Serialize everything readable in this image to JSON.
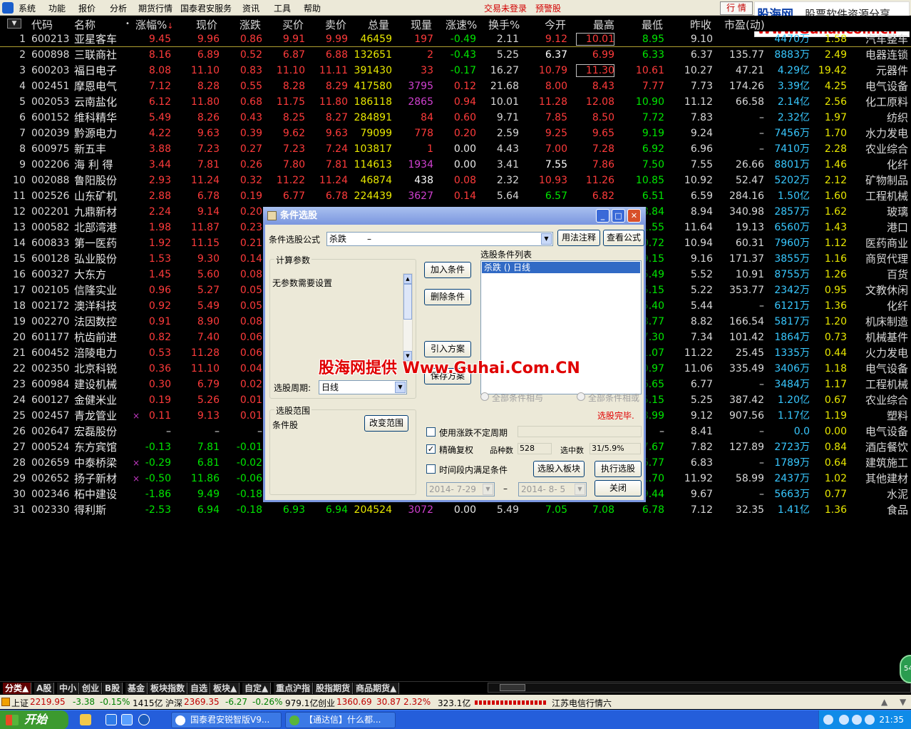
{
  "menu": {
    "items": [
      "系统",
      "功能",
      "报价",
      "分析",
      "期货行情",
      "国泰君安服务",
      "资讯",
      "工具",
      "帮助"
    ],
    "login_status": "交易未登录",
    "alert": "预警股",
    "hq_button": "行 情"
  },
  "banner": {
    "line1": "股海网",
    "line2": "股票软件资源分享",
    "line3": "Www.Guhai.com.cn"
  },
  "columns": {
    "code": "代码",
    "name": "名称",
    "pct": "涨幅%",
    "price": "现价",
    "chg": "涨跌",
    "bid": "买价",
    "ask": "卖价",
    "vol": "总量",
    "cur": "现量",
    "spd": "涨速%",
    "turn": "换手%",
    "open": "今开",
    "high": "最高",
    "low": "最低",
    "pre": "昨收",
    "pe": "市盈(动)"
  },
  "rows": [
    {
      "i": "1",
      "code": "600213",
      "name": "亚星客车",
      "mk": "",
      "pct": "9.45",
      "price": "9.96",
      "chg": "0.86",
      "bid": "9.91",
      "ask": "9.99",
      "vol": "46459",
      "cur": "197",
      "spd": "-0.49",
      "turn": "2.11",
      "open": "9.12",
      "high": "10.01",
      "low": "8.95",
      "pre": "9.10",
      "pe": "",
      "amt": "4470",
      "amtu": "万",
      "x": "1.58",
      "ind": "汽车整车"
    },
    {
      "i": "2",
      "code": "600898",
      "name": "三联商社",
      "mk": "",
      "pct": "8.16",
      "price": "6.89",
      "chg": "0.52",
      "bid": "6.87",
      "ask": "6.88",
      "vol": "132651",
      "cur": "2",
      "spd": "-0.43",
      "turn": "5.25",
      "open": "6.37",
      "high": "6.99",
      "low": "6.33",
      "pre": "6.37",
      "pe": "135.77",
      "amt": "8883",
      "amtu": "万",
      "x": "2.49",
      "ind": "电器连锁"
    },
    {
      "i": "3",
      "code": "600203",
      "name": "福日电子",
      "mk": "",
      "pct": "8.08",
      "price": "11.10",
      "chg": "0.83",
      "bid": "11.10",
      "ask": "11.11",
      "vol": "391430",
      "cur": "33",
      "spd": "-0.17",
      "turn": "16.27",
      "open": "10.79",
      "high": "11.30",
      "low": "10.61",
      "pre": "10.27",
      "pe": "47.21",
      "amt": "4.29",
      "amtu": "亿",
      "x": "19.42",
      "ind": "元器件"
    },
    {
      "i": "4",
      "code": "002451",
      "name": "摩恩电气",
      "mk": "",
      "pct": "7.12",
      "price": "8.28",
      "chg": "0.55",
      "bid": "8.28",
      "ask": "8.29",
      "vol": "417580",
      "cur": "3795",
      "spd": "0.12",
      "turn": "21.68",
      "open": "8.00",
      "high": "8.43",
      "low": "7.77",
      "pre": "7.73",
      "pe": "174.26",
      "amt": "3.39",
      "amtu": "亿",
      "x": "4.25",
      "ind": "电气设备"
    },
    {
      "i": "5",
      "code": "002053",
      "name": "云南盐化",
      "mk": "",
      "pct": "6.12",
      "price": "11.80",
      "chg": "0.68",
      "bid": "11.75",
      "ask": "11.80",
      "vol": "186118",
      "cur": "2865",
      "spd": "0.94",
      "turn": "10.01",
      "open": "11.28",
      "high": "12.08",
      "low": "10.90",
      "pre": "11.12",
      "pe": "66.58",
      "amt": "2.14",
      "amtu": "亿",
      "x": "2.56",
      "ind": "化工原料"
    },
    {
      "i": "6",
      "code": "600152",
      "name": "维科精华",
      "mk": "",
      "pct": "5.49",
      "price": "8.26",
      "chg": "0.43",
      "bid": "8.25",
      "ask": "8.27",
      "vol": "284891",
      "cur": "84",
      "spd": "0.60",
      "turn": "9.71",
      "open": "7.85",
      "high": "8.50",
      "low": "7.72",
      "pre": "7.83",
      "pe": "–",
      "amt": "2.32",
      "amtu": "亿",
      "x": "1.97",
      "ind": "纺织"
    },
    {
      "i": "7",
      "code": "002039",
      "name": "黔源电力",
      "mk": "",
      "pct": "4.22",
      "price": "9.63",
      "chg": "0.39",
      "bid": "9.62",
      "ask": "9.63",
      "vol": "79099",
      "cur": "778",
      "spd": "0.20",
      "turn": "2.59",
      "open": "9.25",
      "high": "9.65",
      "low": "9.19",
      "pre": "9.24",
      "pe": "–",
      "amt": "7456",
      "amtu": "万",
      "x": "1.70",
      "ind": "水力发电"
    },
    {
      "i": "8",
      "code": "600975",
      "name": "新五丰",
      "mk": "",
      "pct": "3.88",
      "price": "7.23",
      "chg": "0.27",
      "bid": "7.23",
      "ask": "7.24",
      "vol": "103817",
      "cur": "1",
      "spd": "0.00",
      "turn": "4.43",
      "open": "7.00",
      "high": "7.28",
      "low": "6.92",
      "pre": "6.96",
      "pe": "–",
      "amt": "7410",
      "amtu": "万",
      "x": "2.28",
      "ind": "农业综合"
    },
    {
      "i": "9",
      "code": "002206",
      "name": "海 利 得",
      "mk": "",
      "pct": "3.44",
      "price": "7.81",
      "chg": "0.26",
      "bid": "7.80",
      "ask": "7.81",
      "vol": "114613",
      "cur": "1934",
      "spd": "0.00",
      "turn": "3.41",
      "open": "7.55",
      "high": "7.86",
      "low": "7.50",
      "pre": "7.55",
      "pe": "26.66",
      "amt": "8801",
      "amtu": "万",
      "x": "1.46",
      "ind": "化纤"
    },
    {
      "i": "10",
      "code": "002088",
      "name": "鲁阳股份",
      "mk": "",
      "pct": "2.93",
      "price": "11.24",
      "chg": "0.32",
      "bid": "11.22",
      "ask": "11.24",
      "vol": "46874",
      "cur": "438",
      "spd": "0.08",
      "turn": "2.32",
      "open": "10.93",
      "high": "11.26",
      "low": "10.85",
      "pre": "10.92",
      "pe": "52.47",
      "amt": "5202",
      "amtu": "万",
      "x": "2.12",
      "ind": "矿物制品"
    },
    {
      "i": "11",
      "code": "002526",
      "name": "山东矿机",
      "mk": "",
      "pct": "2.88",
      "price": "6.78",
      "chg": "0.19",
      "bid": "6.77",
      "ask": "6.78",
      "vol": "224439",
      "cur": "3627",
      "spd": "0.14",
      "turn": "5.64",
      "open": "6.57",
      "high": "6.82",
      "low": "6.51",
      "pre": "6.59",
      "pe": "284.16",
      "amt": "1.50",
      "amtu": "亿",
      "x": "1.60",
      "ind": "工程机械"
    },
    {
      "i": "12",
      "code": "002201",
      "name": "九鼎新材",
      "mk": "",
      "pct": "2.24",
      "price": "9.14",
      "chg": "0.20",
      "bid": "",
      "ask": "",
      "vol": "",
      "cur": "",
      "spd": "",
      "turn": "",
      "open": "",
      "high": "",
      "low": "8.84",
      "pre": "8.94",
      "pe": "340.98",
      "amt": "2857",
      "amtu": "万",
      "x": "1.62",
      "ind": "玻璃"
    },
    {
      "i": "13",
      "code": "000582",
      "name": "北部湾港",
      "mk": "",
      "pct": "1.98",
      "price": "11.87",
      "chg": "0.23",
      "bid": "",
      "ask": "",
      "vol": "",
      "cur": "",
      "spd": "",
      "turn": "",
      "open": "",
      "high": "",
      "low": "1.55",
      "pre": "11.64",
      "pe": "19.13",
      "amt": "6560",
      "amtu": "万",
      "x": "1.43",
      "ind": "港口"
    },
    {
      "i": "14",
      "code": "600833",
      "name": "第一医药",
      "mk": "",
      "pct": "1.92",
      "price": "11.15",
      "chg": "0.21",
      "bid": "",
      "ask": "",
      "vol": "",
      "cur": "",
      "spd": "",
      "turn": "",
      "open": "",
      "high": "",
      "low": "0.72",
      "pre": "10.94",
      "pe": "60.31",
      "amt": "7960",
      "amtu": "万",
      "x": "1.12",
      "ind": "医药商业"
    },
    {
      "i": "15",
      "code": "600128",
      "name": "弘业股份",
      "mk": "",
      "pct": "1.53",
      "price": "9.30",
      "chg": "0.14",
      "bid": "",
      "ask": "",
      "vol": "",
      "cur": "",
      "spd": "",
      "turn": "",
      "open": "",
      "high": "",
      "low": "9.15",
      "pre": "9.16",
      "pe": "171.37",
      "amt": "3855",
      "amtu": "万",
      "x": "1.16",
      "ind": "商贸代理"
    },
    {
      "i": "16",
      "code": "600327",
      "name": "大东方",
      "mk": "",
      "pct": "1.45",
      "price": "5.60",
      "chg": "0.08",
      "bid": "",
      "ask": "",
      "vol": "",
      "cur": "",
      "spd": "",
      "turn": "",
      "open": "",
      "high": "",
      "low": "5.49",
      "pre": "5.52",
      "pe": "10.91",
      "amt": "8755",
      "amtu": "万",
      "x": "1.26",
      "ind": "百货"
    },
    {
      "i": "17",
      "code": "002105",
      "name": "信隆实业",
      "mk": "",
      "pct": "0.96",
      "price": "5.27",
      "chg": "0.05",
      "bid": "",
      "ask": "",
      "vol": "",
      "cur": "",
      "spd": "",
      "turn": "",
      "open": "",
      "high": "",
      "low": "5.15",
      "pre": "5.22",
      "pe": "353.77",
      "amt": "2342",
      "amtu": "万",
      "x": "0.95",
      "ind": "文教休闲"
    },
    {
      "i": "18",
      "code": "002172",
      "name": "澳洋科技",
      "mk": "",
      "pct": "0.92",
      "price": "5.49",
      "chg": "0.05",
      "bid": "",
      "ask": "",
      "vol": "",
      "cur": "",
      "spd": "",
      "turn": "",
      "open": "",
      "high": "",
      "low": "5.40",
      "pre": "5.44",
      "pe": "–",
      "amt": "6121",
      "amtu": "万",
      "x": "1.36",
      "ind": "化纤"
    },
    {
      "i": "19",
      "code": "002270",
      "name": "法因数控",
      "mk": "",
      "pct": "0.91",
      "price": "8.90",
      "chg": "0.08",
      "bid": "",
      "ask": "",
      "vol": "",
      "cur": "",
      "spd": "",
      "turn": "",
      "open": "",
      "high": "",
      "low": "8.77",
      "pre": "8.82",
      "pe": "166.54",
      "amt": "5817",
      "amtu": "万",
      "x": "1.20",
      "ind": "机床制造"
    },
    {
      "i": "20",
      "code": "601177",
      "name": "杭齿前进",
      "mk": "",
      "pct": "0.82",
      "price": "7.40",
      "chg": "0.06",
      "bid": "",
      "ask": "",
      "vol": "",
      "cur": "",
      "spd": "",
      "turn": "",
      "open": "",
      "high": "",
      "low": "7.30",
      "pre": "7.34",
      "pe": "101.42",
      "amt": "1864",
      "amtu": "万",
      "x": "0.73",
      "ind": "机械基件"
    },
    {
      "i": "21",
      "code": "600452",
      "name": "涪陵电力",
      "mk": "",
      "pct": "0.53",
      "price": "11.28",
      "chg": "0.06",
      "bid": "",
      "ask": "",
      "vol": "",
      "cur": "",
      "spd": "",
      "turn": "",
      "open": "",
      "high": "",
      "low": "1.07",
      "pre": "11.22",
      "pe": "25.45",
      "amt": "1335",
      "amtu": "万",
      "x": "0.44",
      "ind": "火力发电"
    },
    {
      "i": "22",
      "code": "002350",
      "name": "北京科锐",
      "mk": "",
      "pct": "0.36",
      "price": "11.10",
      "chg": "0.04",
      "bid": "",
      "ask": "",
      "vol": "",
      "cur": "",
      "spd": "",
      "turn": "",
      "open": "",
      "high": "",
      "low": "0.97",
      "pre": "11.06",
      "pe": "335.49",
      "amt": "3406",
      "amtu": "万",
      "x": "1.18",
      "ind": "电气设备"
    },
    {
      "i": "23",
      "code": "600984",
      "name": "建设机械",
      "mk": "",
      "pct": "0.30",
      "price": "6.79",
      "chg": "0.02",
      "bid": "",
      "ask": "",
      "vol": "",
      "cur": "",
      "spd": "",
      "turn": "",
      "open": "",
      "high": "",
      "low": "6.65",
      "pre": "6.77",
      "pe": "–",
      "amt": "3484",
      "amtu": "万",
      "x": "1.17",
      "ind": "工程机械"
    },
    {
      "i": "24",
      "code": "600127",
      "name": "金健米业",
      "mk": "",
      "pct": "0.19",
      "price": "5.26",
      "chg": "0.01",
      "bid": "",
      "ask": "",
      "vol": "",
      "cur": "",
      "spd": "",
      "turn": "",
      "open": "",
      "high": "",
      "low": "5.15",
      "pre": "5.25",
      "pe": "387.42",
      "amt": "1.20",
      "amtu": "亿",
      "x": "0.67",
      "ind": "农业综合"
    },
    {
      "i": "25",
      "code": "002457",
      "name": "青龙管业",
      "mk": "×",
      "pct": "0.11",
      "price": "9.13",
      "chg": "0.01",
      "bid": "",
      "ask": "",
      "vol": "",
      "cur": "",
      "spd": "",
      "turn": "",
      "open": "",
      "high": "",
      "low": "8.99",
      "pre": "9.12",
      "pe": "907.56",
      "amt": "1.17",
      "amtu": "亿",
      "x": "1.19",
      "ind": "塑料"
    },
    {
      "i": "26",
      "code": "002647",
      "name": "宏磊股份",
      "mk": "",
      "pct": "–",
      "price": "–",
      "chg": "–",
      "bid": "",
      "ask": "",
      "vol": "",
      "cur": "",
      "spd": "",
      "turn": "",
      "open": "",
      "high": "",
      "low": "–",
      "pre": "8.41",
      "pe": "–",
      "amt": "0.0",
      "amtu": "",
      "x": "0.00",
      "ind": "电气设备"
    },
    {
      "i": "27",
      "code": "000524",
      "name": "东方宾馆",
      "mk": "",
      "pct": "-0.13",
      "price": "7.81",
      "chg": "-0.01",
      "bid": "",
      "ask": "",
      "vol": "",
      "cur": "",
      "spd": "",
      "turn": "",
      "open": "",
      "high": "",
      "low": "7.67",
      "pre": "7.82",
      "pe": "127.89",
      "amt": "2723",
      "amtu": "万",
      "x": "0.84",
      "ind": "酒店餐饮"
    },
    {
      "i": "28",
      "code": "002659",
      "name": "中泰桥梁",
      "mk": "×",
      "pct": "-0.29",
      "price": "6.81",
      "chg": "-0.02",
      "bid": "",
      "ask": "",
      "vol": "",
      "cur": "",
      "spd": "",
      "turn": "",
      "open": "",
      "high": "",
      "low": "6.77",
      "pre": "6.83",
      "pe": "–",
      "amt": "1789",
      "amtu": "万",
      "x": "0.64",
      "ind": "建筑施工"
    },
    {
      "i": "29",
      "code": "002652",
      "name": "扬子新材",
      "mk": "×",
      "pct": "-0.50",
      "price": "11.86",
      "chg": "-0.06",
      "bid": "",
      "ask": "",
      "vol": "",
      "cur": "",
      "spd": "",
      "turn": "",
      "open": "",
      "high": "",
      "low": "1.70",
      "pre": "11.92",
      "pe": "58.99",
      "amt": "2437",
      "amtu": "万",
      "x": "1.02",
      "ind": "其他建材"
    },
    {
      "i": "30",
      "code": "002346",
      "name": "柘中建设",
      "mk": "",
      "pct": "-1.86",
      "price": "9.49",
      "chg": "-0.18",
      "bid": "",
      "ask": "",
      "vol": "",
      "cur": "",
      "spd": "",
      "turn": "",
      "open": "",
      "high": "",
      "low": "9.44",
      "pre": "9.67",
      "pe": "–",
      "amt": "5663",
      "amtu": "万",
      "x": "0.77",
      "ind": "水泥"
    },
    {
      "i": "31",
      "code": "002330",
      "name": "得利斯",
      "mk": "",
      "pct": "-2.53",
      "price": "6.94",
      "chg": "-0.18",
      "bid": "6.93",
      "ask": "6.94",
      "vol": "204524",
      "cur": "3072",
      "spd": "0.00",
      "turn": "5.49",
      "open": "7.05",
      "high": "7.08",
      "low": "6.78",
      "pre": "7.12",
      "pe": "32.35",
      "amt": "1.41",
      "amtu": "亿",
      "x": "1.36",
      "ind": "食品"
    }
  ],
  "dialog": {
    "title": "条件选股",
    "formula_label": "条件选股公式",
    "formula_value": "杀跌",
    "formula_desc": "–",
    "usage_btn": "用法注释",
    "view_formula_btn": "查看公式",
    "params_group": "计算参数",
    "params_text": "无参数需要设置",
    "period_label": "选股周期:",
    "period_value": "日线",
    "add_btn": "加入条件",
    "delete_btn": "删除条件",
    "import_btn": "引入方案",
    "save_btn": "保存方案",
    "list_title": "选股条件列表",
    "list_item": "杀跌  ()  日线",
    "radio_and": "全部条件相与",
    "radio_or": "全部条件相或",
    "status": "选股完毕.",
    "range_group": "选股范围",
    "range_text": "条件股",
    "change_range_btn": "改变范围",
    "check_uncertain": "使用涨跌不定周期",
    "check_exright": "精确复权",
    "count_label": "品种数",
    "count_value": "528",
    "selected_label": "选中数",
    "selected_value": "31/5.9%",
    "check_timerange": "时间段内满足条件",
    "to_block_btn": "选股入板块",
    "execute_btn": "执行选股",
    "date_from": "2014- 7-29",
    "date_sep": "–",
    "date_to": "2014- 8- 5",
    "close_btn": "关闭"
  },
  "watermark": "股海网提供 Www.Guhai.Com.CN",
  "bottom_tabs": [
    "分类▲",
    "A股",
    "中小",
    "创业",
    "B股",
    "基金",
    "板块指数",
    "自选",
    "板块▲",
    "自定▲",
    "重点沪指",
    "股指期货",
    "商品期货▲"
  ],
  "ticker": {
    "sh_label": "上证",
    "sh_val": "2219.95",
    "sh_chg": "-3.38",
    "sh_pct": "-0.15%",
    "sh_amt": "1415亿",
    "hs_label": "沪深",
    "hs_val": "2369.35",
    "hs_chg": "-6.27",
    "hs_pct": "-0.26%",
    "hs_amt": "979.1亿",
    "cy_label": "创业",
    "cy_val": "1360.69",
    "cy_chg": "30.87",
    "cy_pct": "2.32%",
    "cy_amt": "323.1亿",
    "server": "江苏电信行情六"
  },
  "taskbar": {
    "start": "开始",
    "task1": "国泰君安锐智版V9...",
    "task2": "【通达信】什么都...",
    "clock": "21:35"
  },
  "side_badge": "54"
}
